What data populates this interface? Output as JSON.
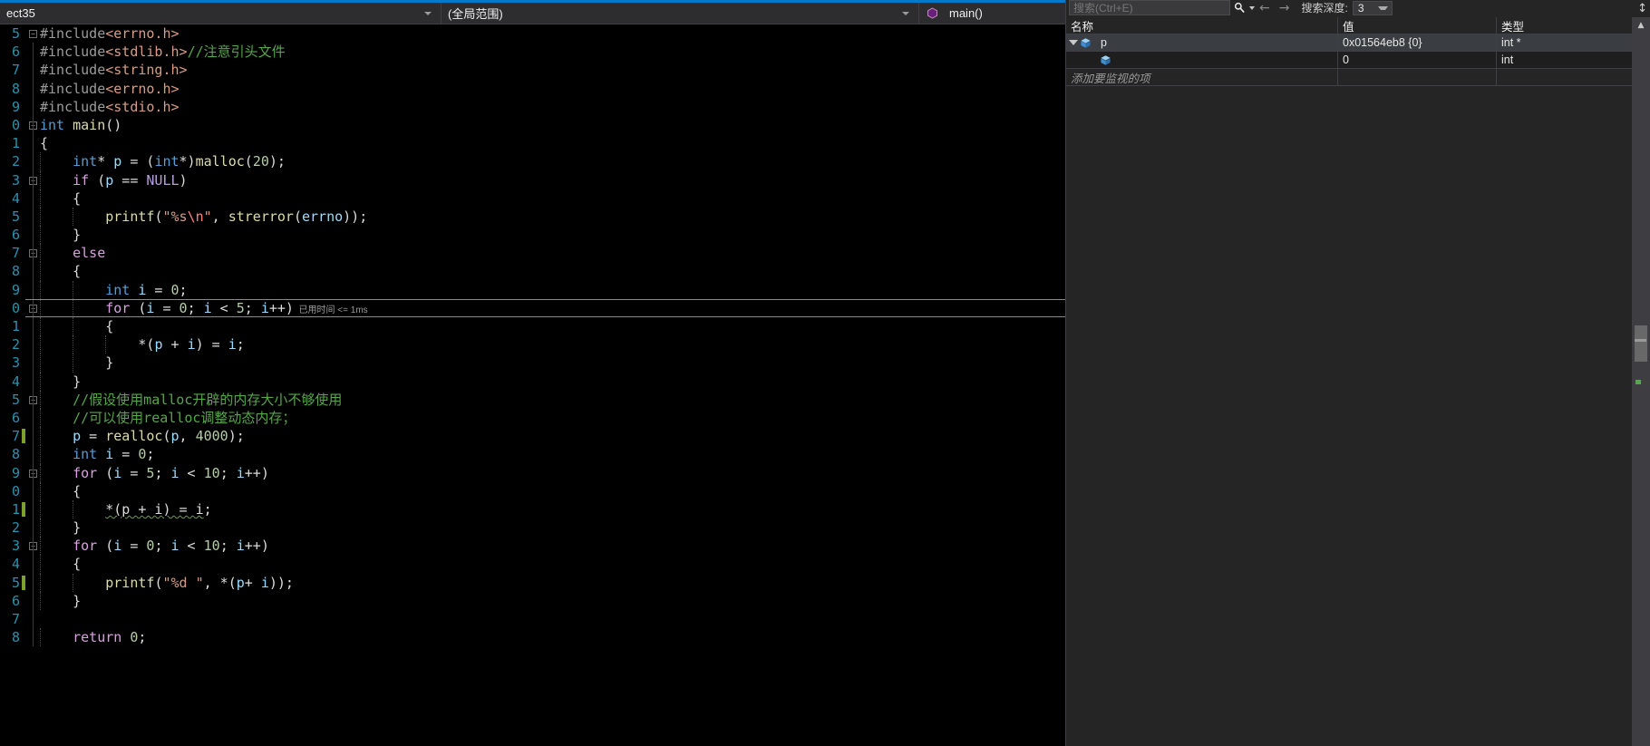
{
  "navbar": {
    "project_selector": "ect35",
    "scope_selector": "(全局范围)",
    "member_selector": "main()",
    "member_icon": "method-icon"
  },
  "editor": {
    "current_line_hint": "已用时间 <= 1ms",
    "lines": [
      {
        "num": "5",
        "indent": 0,
        "fold": "minus",
        "change": false,
        "tokens": [
          {
            "t": "#include",
            "c": "k-pre"
          },
          {
            "t": "<errno.h>",
            "c": "k-inc"
          }
        ]
      },
      {
        "num": "6",
        "indent": 0,
        "fold": "",
        "change": false,
        "tokens": [
          {
            "t": "#include",
            "c": "k-pre"
          },
          {
            "t": "<stdlib.h>",
            "c": "k-inc"
          },
          {
            "t": "//注意引头文件",
            "c": "k-cmt"
          }
        ]
      },
      {
        "num": "7",
        "indent": 0,
        "fold": "",
        "change": false,
        "tokens": [
          {
            "t": "#include",
            "c": "k-pre"
          },
          {
            "t": "<string.h>",
            "c": "k-inc"
          }
        ]
      },
      {
        "num": "8",
        "indent": 0,
        "fold": "",
        "change": false,
        "tokens": [
          {
            "t": "#include",
            "c": "k-pre"
          },
          {
            "t": "<errno.h>",
            "c": "k-inc"
          }
        ]
      },
      {
        "num": "9",
        "indent": 0,
        "fold": "",
        "change": false,
        "tokens": [
          {
            "t": "#include",
            "c": "k-pre"
          },
          {
            "t": "<stdio.h>",
            "c": "k-inc"
          }
        ]
      },
      {
        "num": "0",
        "indent": 0,
        "fold": "minus",
        "change": false,
        "tokens": [
          {
            "t": "int",
            "c": "k-kw"
          },
          {
            "t": " ",
            "c": "k-punct"
          },
          {
            "t": "main",
            "c": "k-fn"
          },
          {
            "t": "()",
            "c": "k-punct"
          }
        ]
      },
      {
        "num": "1",
        "indent": 0,
        "fold": "",
        "change": false,
        "tokens": [
          {
            "t": "{",
            "c": "k-punct"
          }
        ]
      },
      {
        "num": "2",
        "indent": 1,
        "fold": "",
        "change": false,
        "tokens": [
          {
            "t": "    ",
            "c": "k-punct"
          },
          {
            "t": "int",
            "c": "k-kw"
          },
          {
            "t": "* ",
            "c": "k-punct"
          },
          {
            "t": "p",
            "c": "k-var"
          },
          {
            "t": " = (",
            "c": "k-punct"
          },
          {
            "t": "int",
            "c": "k-kw"
          },
          {
            "t": "*)",
            "c": "k-punct"
          },
          {
            "t": "malloc",
            "c": "k-fn"
          },
          {
            "t": "(",
            "c": "k-punct"
          },
          {
            "t": "20",
            "c": "k-num"
          },
          {
            "t": ");",
            "c": "k-punct"
          }
        ]
      },
      {
        "num": "3",
        "indent": 1,
        "fold": "minus",
        "change": false,
        "tokens": [
          {
            "t": "    ",
            "c": "k-punct"
          },
          {
            "t": "if",
            "c": "k-ctrl"
          },
          {
            "t": " (",
            "c": "k-punct"
          },
          {
            "t": "p",
            "c": "k-var"
          },
          {
            "t": " == ",
            "c": "k-punct"
          },
          {
            "t": "NULL",
            "c": "k-mac"
          },
          {
            "t": ")",
            "c": "k-punct"
          }
        ]
      },
      {
        "num": "4",
        "indent": 1,
        "fold": "",
        "change": false,
        "tokens": [
          {
            "t": "    {",
            "c": "k-punct"
          }
        ]
      },
      {
        "num": "5",
        "indent": 2,
        "fold": "",
        "change": false,
        "tokens": [
          {
            "t": "        ",
            "c": "k-punct"
          },
          {
            "t": "printf",
            "c": "k-fn"
          },
          {
            "t": "(",
            "c": "k-punct"
          },
          {
            "t": "\"%s",
            "c": "k-str"
          },
          {
            "t": "\\n",
            "c": "k-esc"
          },
          {
            "t": "\"",
            "c": "k-str"
          },
          {
            "t": ", ",
            "c": "k-punct"
          },
          {
            "t": "strerror",
            "c": "k-fn"
          },
          {
            "t": "(",
            "c": "k-punct"
          },
          {
            "t": "errno",
            "c": "k-var"
          },
          {
            "t": "));",
            "c": "k-punct"
          }
        ]
      },
      {
        "num": "6",
        "indent": 1,
        "fold": "",
        "change": false,
        "tokens": [
          {
            "t": "    }",
            "c": "k-punct"
          }
        ]
      },
      {
        "num": "7",
        "indent": 1,
        "fold": "minus",
        "change": false,
        "tokens": [
          {
            "t": "    ",
            "c": "k-punct"
          },
          {
            "t": "else",
            "c": "k-ctrl"
          }
        ]
      },
      {
        "num": "8",
        "indent": 1,
        "fold": "",
        "change": false,
        "tokens": [
          {
            "t": "    {",
            "c": "k-punct"
          }
        ]
      },
      {
        "num": "9",
        "indent": 2,
        "fold": "",
        "change": false,
        "tokens": [
          {
            "t": "        ",
            "c": "k-punct"
          },
          {
            "t": "int",
            "c": "k-kw"
          },
          {
            "t": " ",
            "c": "k-punct"
          },
          {
            "t": "i",
            "c": "k-var"
          },
          {
            "t": " = ",
            "c": "k-punct"
          },
          {
            "t": "0",
            "c": "k-num"
          },
          {
            "t": ";",
            "c": "k-punct"
          }
        ]
      },
      {
        "num": "0",
        "indent": 2,
        "fold": "minus",
        "change": false,
        "current": true,
        "tokens": [
          {
            "t": "        ",
            "c": "k-punct"
          },
          {
            "t": "for",
            "c": "k-ctrl"
          },
          {
            "t": " (",
            "c": "k-punct"
          },
          {
            "t": "i",
            "c": "k-var"
          },
          {
            "t": " = ",
            "c": "k-punct"
          },
          {
            "t": "0",
            "c": "k-num"
          },
          {
            "t": "; ",
            "c": "k-punct"
          },
          {
            "t": "i",
            "c": "k-var"
          },
          {
            "t": " < ",
            "c": "k-punct"
          },
          {
            "t": "5",
            "c": "k-num"
          },
          {
            "t": "; ",
            "c": "k-punct"
          },
          {
            "t": "i",
            "c": "k-var"
          },
          {
            "t": "++)",
            "c": "k-punct"
          }
        ]
      },
      {
        "num": "1",
        "indent": 2,
        "fold": "",
        "change": false,
        "tokens": [
          {
            "t": "        {",
            "c": "k-punct"
          }
        ]
      },
      {
        "num": "2",
        "indent": 3,
        "fold": "",
        "change": false,
        "tokens": [
          {
            "t": "            *(",
            "c": "k-punct"
          },
          {
            "t": "p",
            "c": "k-var"
          },
          {
            "t": " + ",
            "c": "k-punct"
          },
          {
            "t": "i",
            "c": "k-var"
          },
          {
            "t": ") = ",
            "c": "k-punct"
          },
          {
            "t": "i",
            "c": "k-var"
          },
          {
            "t": ";",
            "c": "k-punct"
          }
        ]
      },
      {
        "num": "3",
        "indent": 2,
        "fold": "",
        "change": false,
        "tokens": [
          {
            "t": "        }",
            "c": "k-punct"
          }
        ]
      },
      {
        "num": "4",
        "indent": 1,
        "fold": "",
        "change": false,
        "tokens": [
          {
            "t": "    }",
            "c": "k-punct"
          }
        ]
      },
      {
        "num": "5",
        "indent": 1,
        "fold": "minus",
        "change": false,
        "tokens": [
          {
            "t": "    //假设使用malloc开辟的内存大小不够使用",
            "c": "k-cmt"
          }
        ]
      },
      {
        "num": "6",
        "indent": 1,
        "fold": "",
        "change": false,
        "tokens": [
          {
            "t": "    //可以使用realloc调整动态内存；",
            "c": "k-cmt"
          }
        ]
      },
      {
        "num": "7",
        "indent": 1,
        "fold": "",
        "change": true,
        "tokens": [
          {
            "t": "    ",
            "c": "k-punct"
          },
          {
            "t": "p",
            "c": "k-var"
          },
          {
            "t": " = ",
            "c": "k-punct"
          },
          {
            "t": "realloc",
            "c": "k-fn"
          },
          {
            "t": "(",
            "c": "k-punct"
          },
          {
            "t": "p",
            "c": "k-var"
          },
          {
            "t": ", ",
            "c": "k-punct"
          },
          {
            "t": "4000",
            "c": "k-num"
          },
          {
            "t": ");",
            "c": "k-punct"
          }
        ]
      },
      {
        "num": "8",
        "indent": 1,
        "fold": "",
        "change": false,
        "tokens": [
          {
            "t": "    ",
            "c": "k-punct"
          },
          {
            "t": "int",
            "c": "k-kw"
          },
          {
            "t": " ",
            "c": "k-punct"
          },
          {
            "t": "i",
            "c": "k-var"
          },
          {
            "t": " = ",
            "c": "k-punct"
          },
          {
            "t": "0",
            "c": "k-num"
          },
          {
            "t": ";",
            "c": "k-punct"
          }
        ]
      },
      {
        "num": "9",
        "indent": 1,
        "fold": "minus",
        "change": false,
        "tokens": [
          {
            "t": "    ",
            "c": "k-punct"
          },
          {
            "t": "for",
            "c": "k-ctrl"
          },
          {
            "t": " (",
            "c": "k-punct"
          },
          {
            "t": "i",
            "c": "k-var"
          },
          {
            "t": " = ",
            "c": "k-punct"
          },
          {
            "t": "5",
            "c": "k-num"
          },
          {
            "t": "; ",
            "c": "k-punct"
          },
          {
            "t": "i",
            "c": "k-var"
          },
          {
            "t": " < ",
            "c": "k-punct"
          },
          {
            "t": "10",
            "c": "k-num"
          },
          {
            "t": "; ",
            "c": "k-punct"
          },
          {
            "t": "i",
            "c": "k-var"
          },
          {
            "t": "++)",
            "c": "k-punct"
          }
        ]
      },
      {
        "num": "0",
        "indent": 1,
        "fold": "",
        "change": false,
        "tokens": [
          {
            "t": "    {",
            "c": "k-punct"
          }
        ]
      },
      {
        "num": "1",
        "indent": 2,
        "fold": "",
        "change": true,
        "tokens": [
          {
            "t": "        ",
            "c": "k-punct"
          },
          {
            "t": "*(p + i) = i",
            "c": "k-punct squiggle"
          },
          {
            "t": ";",
            "c": "k-punct"
          }
        ]
      },
      {
        "num": "2",
        "indent": 1,
        "fold": "",
        "change": false,
        "tokens": [
          {
            "t": "    }",
            "c": "k-punct"
          }
        ]
      },
      {
        "num": "3",
        "indent": 1,
        "fold": "minus",
        "change": false,
        "tokens": [
          {
            "t": "    ",
            "c": "k-punct"
          },
          {
            "t": "for",
            "c": "k-ctrl"
          },
          {
            "t": " (",
            "c": "k-punct"
          },
          {
            "t": "i",
            "c": "k-var"
          },
          {
            "t": " = ",
            "c": "k-punct"
          },
          {
            "t": "0",
            "c": "k-num"
          },
          {
            "t": "; ",
            "c": "k-punct"
          },
          {
            "t": "i",
            "c": "k-var"
          },
          {
            "t": " < ",
            "c": "k-punct"
          },
          {
            "t": "10",
            "c": "k-num"
          },
          {
            "t": "; ",
            "c": "k-punct"
          },
          {
            "t": "i",
            "c": "k-var"
          },
          {
            "t": "++)",
            "c": "k-punct"
          }
        ]
      },
      {
        "num": "4",
        "indent": 1,
        "fold": "",
        "change": false,
        "tokens": [
          {
            "t": "    {",
            "c": "k-punct"
          }
        ]
      },
      {
        "num": "5",
        "indent": 2,
        "fold": "",
        "change": true,
        "tokens": [
          {
            "t": "        ",
            "c": "k-punct"
          },
          {
            "t": "printf",
            "c": "k-fn"
          },
          {
            "t": "(",
            "c": "k-punct"
          },
          {
            "t": "\"%d \"",
            "c": "k-str"
          },
          {
            "t": ", *(",
            "c": "k-punct"
          },
          {
            "t": "p",
            "c": "k-var"
          },
          {
            "t": "+ ",
            "c": "k-punct"
          },
          {
            "t": "i",
            "c": "k-var"
          },
          {
            "t": "));",
            "c": "k-punct"
          }
        ]
      },
      {
        "num": "6",
        "indent": 1,
        "fold": "",
        "change": false,
        "tokens": [
          {
            "t": "    }",
            "c": "k-punct"
          }
        ]
      },
      {
        "num": "7",
        "indent": 0,
        "fold": "",
        "change": false,
        "tokens": []
      },
      {
        "num": "8",
        "indent": 1,
        "fold": "",
        "change": false,
        "tokens": [
          {
            "t": "    ",
            "c": "k-punct"
          },
          {
            "t": "return",
            "c": "k-ctrl"
          },
          {
            "t": " ",
            "c": "k-punct"
          },
          {
            "t": "0",
            "c": "k-num"
          },
          {
            "t": ";",
            "c": "k-punct"
          }
        ]
      }
    ]
  },
  "watch": {
    "search_placeholder": "搜索(Ctrl+E)",
    "search_value": "",
    "search_icon": "magnifier-icon",
    "nav_back_icon": "arrow-left-icon",
    "nav_forward_icon": "arrow-right-icon",
    "depth_label": "搜索深度:",
    "depth_value": "3",
    "columns": [
      "名称",
      "值",
      "类型"
    ],
    "rows": [
      {
        "name": "p",
        "value": "0x01564eb8 {0}",
        "type": "int *",
        "expanded": true,
        "child": false,
        "selected": true
      },
      {
        "name": "",
        "value": "0",
        "type": "int",
        "expanded": false,
        "child": true,
        "selected": false
      }
    ],
    "add_watch_placeholder": "添加要监视的项",
    "scroll_up_icon": "scroll-up-arrow",
    "scroll_down_icon": "scroll-down-arrow",
    "splitter_icon": "splitter-icon"
  }
}
